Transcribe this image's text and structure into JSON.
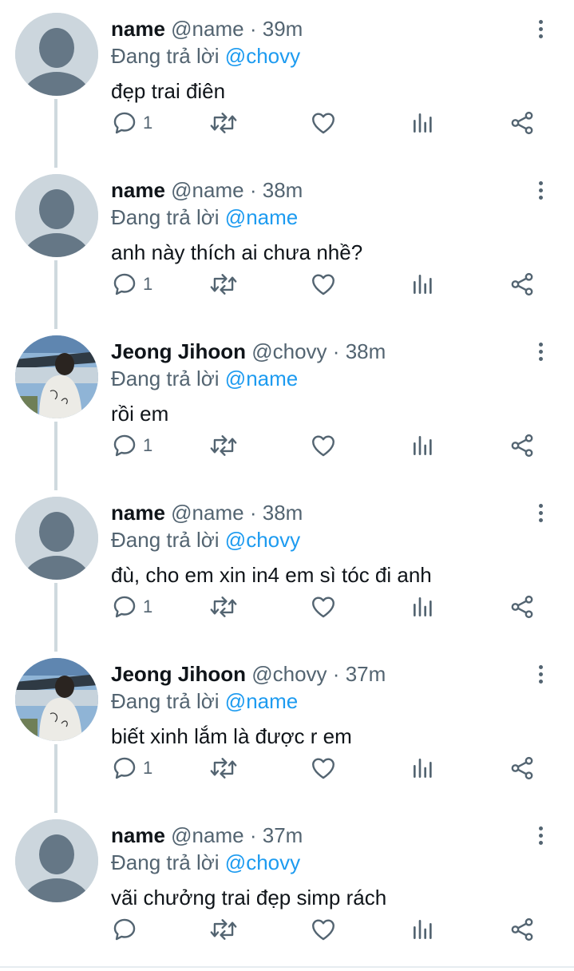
{
  "reply_prefix": "Đang trả lời",
  "icons": {
    "more": "more-vertical-icon",
    "reply": "reply-icon",
    "retweet": "retweet-icon",
    "like": "like-icon",
    "views": "views-icon",
    "share": "share-icon"
  },
  "colors": {
    "mention": "#1d9bf0",
    "secondary_text": "#536471",
    "thread_line": "#cfd9de",
    "default_avatar_bg": "#ccd6dd",
    "default_avatar_fg": "#657786"
  },
  "tweets": [
    {
      "display_name": "name",
      "handle": "@name",
      "sep": "·",
      "time": "39m",
      "mention": "@chovy",
      "text": "đẹp trai điên",
      "reply_count": "1",
      "avatar": "default"
    },
    {
      "display_name": "name",
      "handle": "@name",
      "sep": "·",
      "time": "38m",
      "mention": "@name",
      "text": "anh này thích ai chưa nhề?",
      "reply_count": "1",
      "avatar": "default"
    },
    {
      "display_name": "Jeong Jihoon",
      "handle": "@chovy",
      "sep": "·",
      "time": "38m",
      "mention": "@name",
      "text": "rồi em",
      "reply_count": "1",
      "avatar": "photo"
    },
    {
      "display_name": "name",
      "handle": "@name",
      "sep": "·",
      "time": "38m",
      "mention": "@chovy",
      "text": "đù, cho em xin in4 em sì tóc đi anh",
      "reply_count": "1",
      "avatar": "default"
    },
    {
      "display_name": "Jeong Jihoon",
      "handle": "@chovy",
      "sep": "·",
      "time": "37m",
      "mention": "@name",
      "text": "biết xinh lắm là được r em",
      "reply_count": "1",
      "avatar": "photo"
    },
    {
      "display_name": "name",
      "handle": "@name",
      "sep": "·",
      "time": "37m",
      "mention": "@chovy",
      "text": "vãi chưởng trai đẹp simp rách",
      "reply_count": "",
      "avatar": "default"
    }
  ]
}
